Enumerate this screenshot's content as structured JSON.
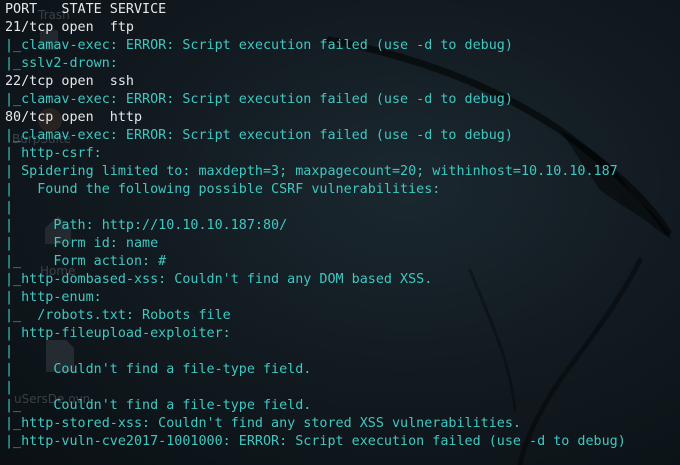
{
  "theme": {
    "background": "#121b21",
    "text_primary": "#e4e8ec",
    "text_script": "#3fc8c2"
  },
  "desktop_icons": [
    {
      "name": "trash-icon",
      "label": "Trash"
    },
    {
      "name": "burpsuite-icon",
      "label": "BurpSuite"
    },
    {
      "name": "home-icon",
      "label": "Home"
    },
    {
      "name": "file-icon",
      "label": "uSersDe.ovn"
    }
  ],
  "terminal": {
    "lines": [
      {
        "type": "hdr",
        "text": "PORT   STATE SERVICE"
      },
      {
        "type": "port",
        "text": "21/tcp open  ftp"
      },
      {
        "type": "bar",
        "text": "|_clamav-exec: ERROR: Script execution failed (use -d to debug)"
      },
      {
        "type": "bar",
        "text": "|_sslv2-drown: "
      },
      {
        "type": "port",
        "text": "22/tcp open  ssh"
      },
      {
        "type": "bar",
        "text": "|_clamav-exec: ERROR: Script execution failed (use -d to debug)"
      },
      {
        "type": "port",
        "text": "80/tcp open  http"
      },
      {
        "type": "bar",
        "text": "|_clamav-exec: ERROR: Script execution failed (use -d to debug)"
      },
      {
        "type": "bar",
        "text": "| http-csrf: "
      },
      {
        "type": "bar",
        "text": "| Spidering limited to: maxdepth=3; maxpagecount=20; withinhost=10.10.10.187"
      },
      {
        "type": "bar",
        "text": "|   Found the following possible CSRF vulnerabilities: "
      },
      {
        "type": "bar",
        "text": "|     "
      },
      {
        "type": "bar",
        "text": "|     Path: http://10.10.10.187:80/"
      },
      {
        "type": "bar",
        "text": "|     Form id: name"
      },
      {
        "type": "bar",
        "text": "|_    Form action: #"
      },
      {
        "type": "bar",
        "text": "|_http-dombased-xss: Couldn't find any DOM based XSS."
      },
      {
        "type": "bar",
        "text": "| http-enum: "
      },
      {
        "type": "bar",
        "text": "|_  /robots.txt: Robots file"
      },
      {
        "type": "bar",
        "text": "| http-fileupload-exploiter: "
      },
      {
        "type": "bar",
        "text": "|   "
      },
      {
        "type": "bar",
        "text": "|     Couldn't find a file-type field."
      },
      {
        "type": "bar",
        "text": "|   "
      },
      {
        "type": "bar",
        "text": "|_    Couldn't find a file-type field."
      },
      {
        "type": "bar",
        "text": "|_http-stored-xss: Couldn't find any stored XSS vulnerabilities."
      },
      {
        "type": "bar",
        "text": "|_http-vuln-cve2017-1001000: ERROR: Script execution failed (use -d to debug)"
      }
    ]
  }
}
